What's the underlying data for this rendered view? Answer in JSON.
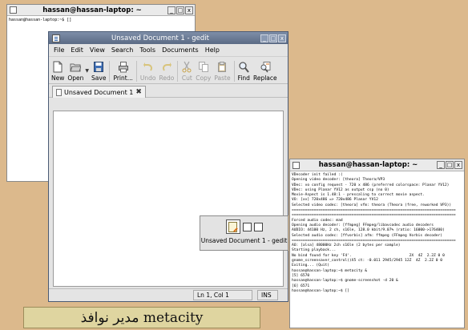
{
  "terminal1": {
    "title": "hassan@hassan-laptop: ~",
    "lines": [
      "hassan@hassan-laptop:~$ []"
    ]
  },
  "gedit": {
    "title": "Unsaved Document 1 - gedit",
    "menu": [
      "File",
      "Edit",
      "View",
      "Search",
      "Tools",
      "Documents",
      "Help"
    ],
    "toolbar": {
      "new": "New",
      "open": "Open",
      "save": "Save",
      "print": "Print...",
      "undo": "Undo",
      "redo": "Redo",
      "cut": "Cut",
      "copy": "Copy",
      "paste": "Paste",
      "find": "Find",
      "replace": "Replace"
    },
    "tab_label": "Unsaved Document 1",
    "status_position": "Ln 1, Col 1",
    "status_mode": "INS"
  },
  "switcher": {
    "label": "Unsaved Document 1 - gedit"
  },
  "terminal2": {
    "title": "hassan@hassan-laptop: ~",
    "lines": [
      "VDecoder init failed :(",
      "Opening video decoder: [theora] Theora/VP3",
      "VDec: vo config request - 720 x 486 (preferred colorspace: Planar YV12)",
      "VDec: using Planar YV12 as output csp (no 0)",
      "Movie-Aspect is 1.48:1 - prescaling to correct movie aspect.",
      "VO: [xv] 720x486 => 720x486 Planar YV12",
      "Selected video codec: [theora] vfm: theora (Theora (free, reworked VP3))",
      "==========================================================================",
      "==========================================================================",
      "Forced audio codec: mad",
      "Opening audio decoder: [ffmpeg] FFmpeg/libavcodec audio decoders",
      "AUDIO: 44100 Hz, 2 ch, s16le, 128.0 kbit/9.07% (ratio: 16000->176400)",
      "Selected audio codec: [ffvorbis] afm: ffmpeg (FFmpeg Vorbis decoder)",
      "==========================================================================",
      "AO: [alsa] 48000Hz 2ch s16le (2 bytes per sample)",
      "Starting playback...",
      "No bind found for key 'F4'.                          2X  4Z  2.2Z 0 0",
      "gnome_screensaver_control()X5 ct: -0.011 2945/2945 12Z  4Z  2.2Z 0 0",
      "Exiting... (Quit)",
      "hassan@hassan-laptop:~$ metacity &",
      "[5] 6570",
      "hassan@hassan-laptop:~$ gnome-screenshot -d 20 &",
      "[6] 6571",
      "hassan@hassan-laptop:~$ []"
    ]
  },
  "caption": {
    "text": "مدير نوافذ metacity"
  },
  "colors": {
    "desktop": "#dcb98c",
    "gedit_titlebar": "#6b7b95",
    "caption_bg": "#dfd5a0"
  }
}
